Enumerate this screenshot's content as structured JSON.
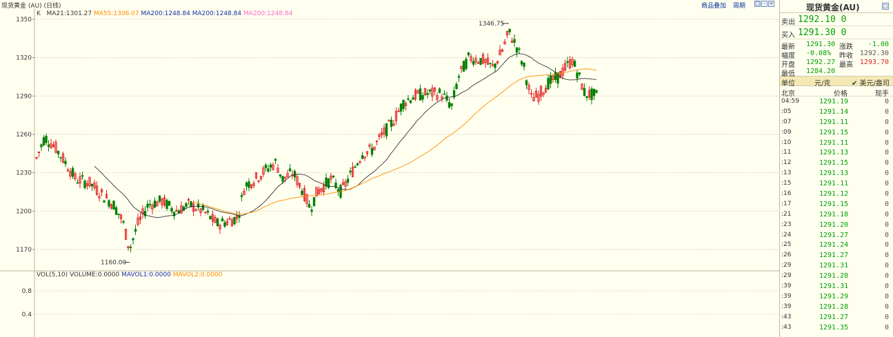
{
  "window": {
    "title": "现货黄金(AU)",
    "chart_tab": "现货黄金 (AU)  (日线)",
    "overlay_button": "商品叠加",
    "period_button": "周期"
  },
  "legend_main": {
    "k_label": "K",
    "ma21": "MA21:1301.27",
    "ma55": "MA55:1306.07",
    "ma200a": "MA200:1248.84",
    "ma200b": "MA200:1248.84",
    "ma200c": "MA200:1248.84",
    "colors": {
      "ma21": "#333333",
      "ma55": "#ff8c00",
      "ma200": "#1a3fd6",
      "ma200c": "#ff66cc"
    }
  },
  "legend_vol": {
    "label": "VOL(5,10)",
    "volume": "VOLUME:0.0000",
    "mavol1": "MAVOL1:0.0000",
    "mavol2": "MAVOL2:0.0000"
  },
  "chart_data": {
    "type": "candlestick",
    "y_axis_labels": [
      "1350",
      "1320",
      "1290",
      "1260",
      "1230",
      "1200",
      "1170"
    ],
    "ylim": [
      1155,
      1355
    ],
    "vol_axis_labels": [
      "0.8",
      "0.4"
    ],
    "annotations": {
      "high": "1346.75",
      "low": "1160.00"
    },
    "up_color": "#e02020",
    "down_color": "#008000"
  },
  "quote": {
    "sell_label": "卖出",
    "sell_price": "1292.10",
    "sell_vol": "0",
    "buy_label": "买入",
    "buy_price": "1291.30",
    "buy_vol": "0",
    "latest_label": "最新",
    "latest": "1291.30",
    "change_label": "涨跌",
    "change": "-1.00",
    "pct_label": "幅度",
    "pct": "-0.08%",
    "prev_label": "昨收",
    "prev": "1292.30",
    "open_label": "开盘",
    "open": "1292.27",
    "high_label": "最高",
    "high": "1293.70",
    "low_label": "最低",
    "low": "1284.20",
    "unit_label": "单位",
    "unit_yuan": "元/克",
    "unit_usd": "✔ 美元/盎司",
    "col_time": "北京",
    "col_price": "价格",
    "col_vol": "现手"
  },
  "ticks": [
    {
      "t": "04:59",
      "p": "1291.19",
      "v": "0"
    },
    {
      "t": ":05",
      "p": "1291.14",
      "v": "0"
    },
    {
      "t": ":07",
      "p": "1291.11",
      "v": "0"
    },
    {
      "t": ":09",
      "p": "1291.15",
      "v": "0"
    },
    {
      "t": ":10",
      "p": "1291.11",
      "v": "0"
    },
    {
      "t": ":11",
      "p": "1291.13",
      "v": "0"
    },
    {
      "t": ":12",
      "p": "1291.15",
      "v": "0"
    },
    {
      "t": ":13",
      "p": "1291.13",
      "v": "0"
    },
    {
      "t": ":15",
      "p": "1291.11",
      "v": "0"
    },
    {
      "t": ":16",
      "p": "1291.12",
      "v": "0"
    },
    {
      "t": ":17",
      "p": "1291.15",
      "v": "0"
    },
    {
      "t": ":21",
      "p": "1291.18",
      "v": "0"
    },
    {
      "t": ":23",
      "p": "1291.20",
      "v": "0"
    },
    {
      "t": ":24",
      "p": "1291.27",
      "v": "0"
    },
    {
      "t": ":25",
      "p": "1291.24",
      "v": "0"
    },
    {
      "t": ":26",
      "p": "1291.27",
      "v": "0"
    },
    {
      "t": ":29",
      "p": "1291.31",
      "v": "0"
    },
    {
      "t": ":29",
      "p": "1291.28",
      "v": "0"
    },
    {
      "t": ":39",
      "p": "1291.31",
      "v": "0"
    },
    {
      "t": ":39",
      "p": "1291.29",
      "v": "0"
    },
    {
      "t": ":39",
      "p": "1291.28",
      "v": "0"
    },
    {
      "t": ":43",
      "p": "1291.27",
      "v": "0"
    },
    {
      "t": ":43",
      "p": "1291.35",
      "v": "0"
    }
  ]
}
